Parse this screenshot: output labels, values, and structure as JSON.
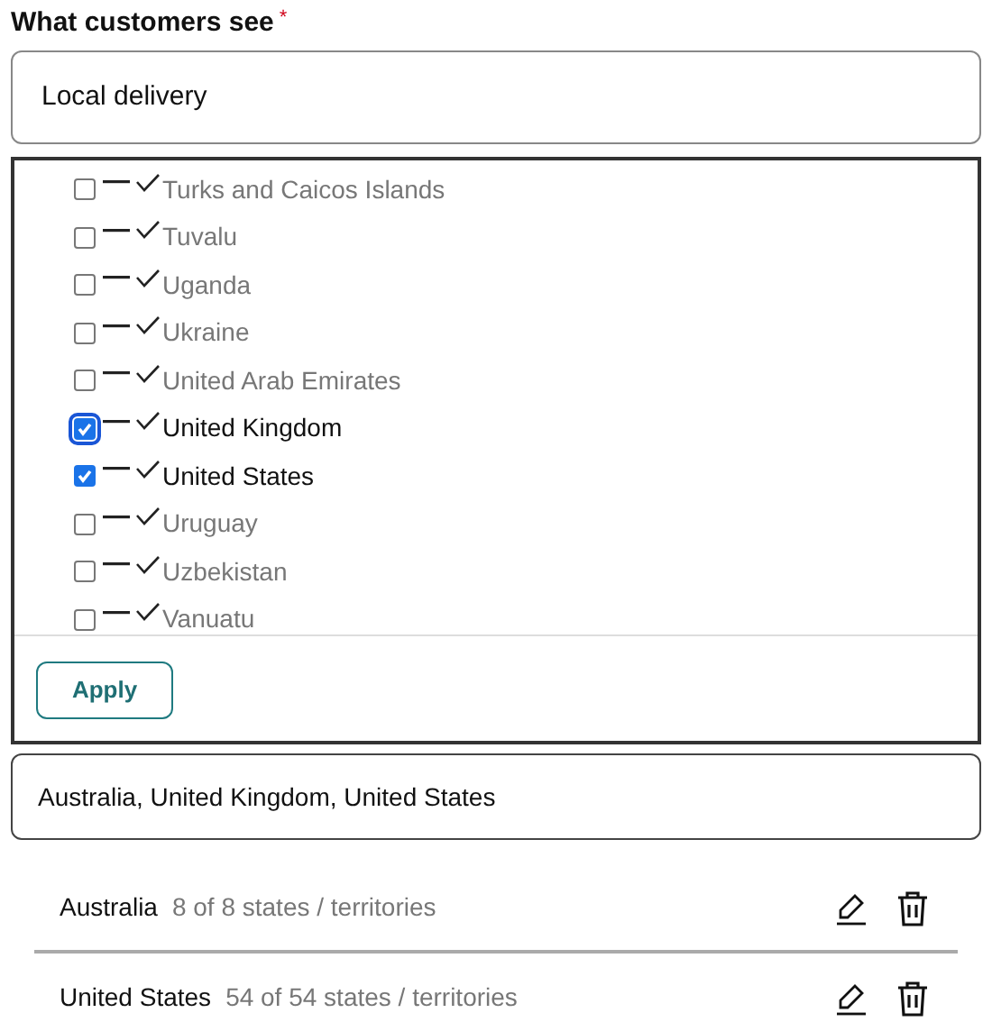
{
  "label": {
    "text": "What customers see",
    "required_mark": "*"
  },
  "name_field": {
    "value": "Local delivery"
  },
  "countries": [
    {
      "name": "Turks and Caicos Islands",
      "checked": false,
      "focused": false
    },
    {
      "name": "Tuvalu",
      "checked": false,
      "focused": false
    },
    {
      "name": "Uganda",
      "checked": false,
      "focused": false
    },
    {
      "name": "Ukraine",
      "checked": false,
      "focused": false
    },
    {
      "name": "United Arab Emirates",
      "checked": false,
      "focused": false
    },
    {
      "name": "United Kingdom",
      "checked": true,
      "focused": true
    },
    {
      "name": "United States",
      "checked": true,
      "focused": false
    },
    {
      "name": "Uruguay",
      "checked": false,
      "focused": false
    },
    {
      "name": "Uzbekistan",
      "checked": false,
      "focused": false
    },
    {
      "name": "Vanuatu",
      "checked": false,
      "focused": false
    }
  ],
  "apply_button": "Apply",
  "summary_field": {
    "value": "Australia, United Kingdom, United States"
  },
  "regions": [
    {
      "name": "Australia",
      "detail": "8 of 8 states / territories"
    },
    {
      "name": "United States",
      "detail": "54 of 54 states / territories"
    }
  ]
}
